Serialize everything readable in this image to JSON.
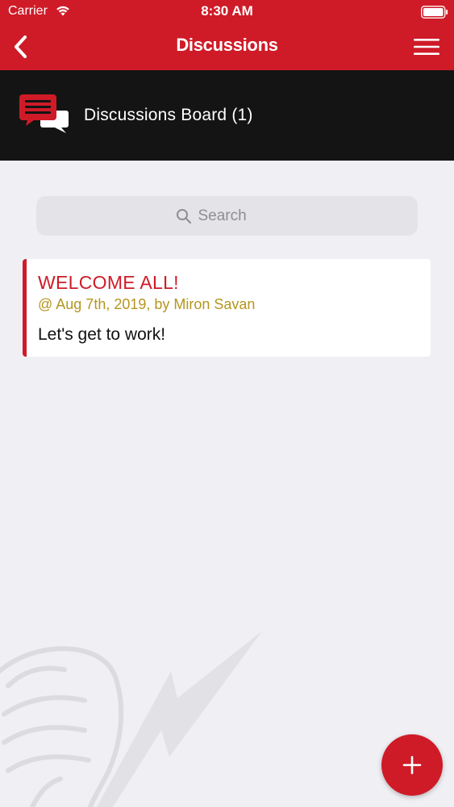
{
  "colors": {
    "brand": "#cf1b27",
    "meta": "#b5961f"
  },
  "status_bar": {
    "carrier": "Carrier",
    "time": "8:30 AM",
    "icons": [
      "wifi-icon",
      "battery-icon"
    ]
  },
  "nav": {
    "title": "Discussions",
    "back_icon": "chevron-left-icon",
    "menu_icon": "hamburger-menu-icon"
  },
  "board": {
    "title": "Discussions Board (1)",
    "icon": "chat-bubbles-icon"
  },
  "search": {
    "placeholder": "Search",
    "icon": "search-icon"
  },
  "posts": [
    {
      "title": "WELCOME ALL!",
      "meta": "@ Aug 7th, 2019, by Miron Savan",
      "body": "Let's get to work!"
    }
  ],
  "fab": {
    "icon": "plus-icon"
  }
}
